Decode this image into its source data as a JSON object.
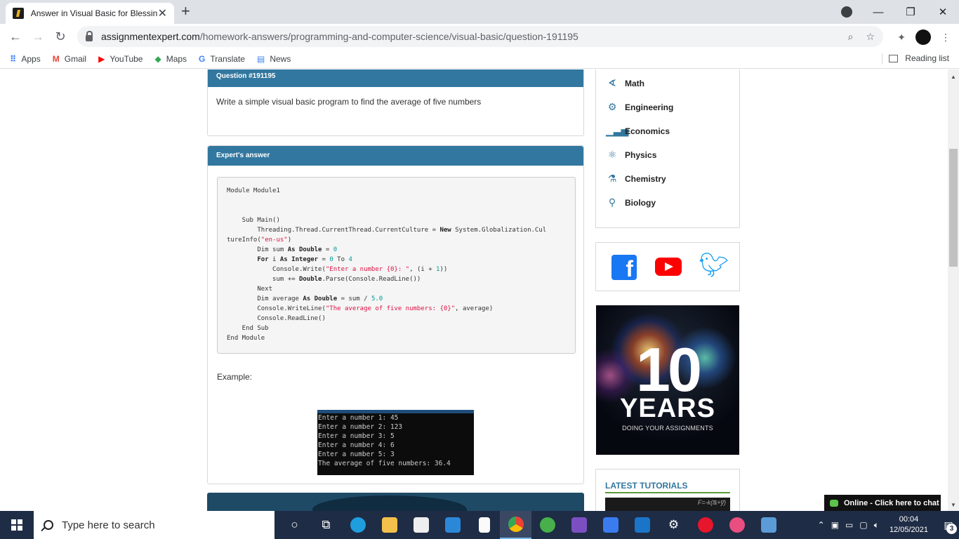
{
  "browser": {
    "tab_title": "Answer in Visual Basic for Blessin",
    "tab_close": "✕",
    "new_tab": "+",
    "url_domain": "assignmentexpert.com",
    "url_path": "/homework-answers/programming-and-computer-science/visual-basic/question-191195",
    "bookmarks": [
      {
        "label": "Apps",
        "icon": "apps-grid-icon"
      },
      {
        "label": "Gmail",
        "icon": "gmail-icon"
      },
      {
        "label": "YouTube",
        "icon": "youtube-icon"
      },
      {
        "label": "Maps",
        "icon": "maps-icon"
      },
      {
        "label": "Translate",
        "icon": "translate-icon"
      },
      {
        "label": "News",
        "icon": "news-icon"
      }
    ],
    "reading_list": "Reading list"
  },
  "question": {
    "header": "Question #191195",
    "text": "Write a simple visual basic program to find the average of five numbers"
  },
  "answer": {
    "header": "Expert's answer",
    "example_label": "Example:",
    "console_lines": [
      "Enter a number 1: 45",
      "Enter a number 2: 123",
      "Enter a number 3: 5",
      "Enter a number 4: 6",
      "Enter a number 5: 3",
      "The average of five numbers: 36.4"
    ]
  },
  "sidebar": {
    "categories": [
      {
        "label": "Math",
        "icon": "math-icon"
      },
      {
        "label": "Engineering",
        "icon": "gear-icon"
      },
      {
        "label": "Economics",
        "icon": "bar-chart-icon"
      },
      {
        "label": "Physics",
        "icon": "atom-icon"
      },
      {
        "label": "Chemistry",
        "icon": "flask-icon"
      },
      {
        "label": "Biology",
        "icon": "microscope-icon"
      }
    ],
    "banner_number": "10",
    "banner_years": "YEARS",
    "banner_tagline": "DOING YOUR ASSIGNMENTS",
    "latest_title": "LATEST TUTORIALS",
    "latest_thumb_text": "F=-k(a̅ᵢ+y̅)"
  },
  "chat": {
    "label": "Online - Click here to chat"
  },
  "taskbar": {
    "search_placeholder": "Type here to search",
    "time": "00:04",
    "date": "12/05/2021",
    "notifications": "3"
  },
  "colors": {
    "header_blue": "#32779f",
    "taskbar": "#1f2c45"
  }
}
